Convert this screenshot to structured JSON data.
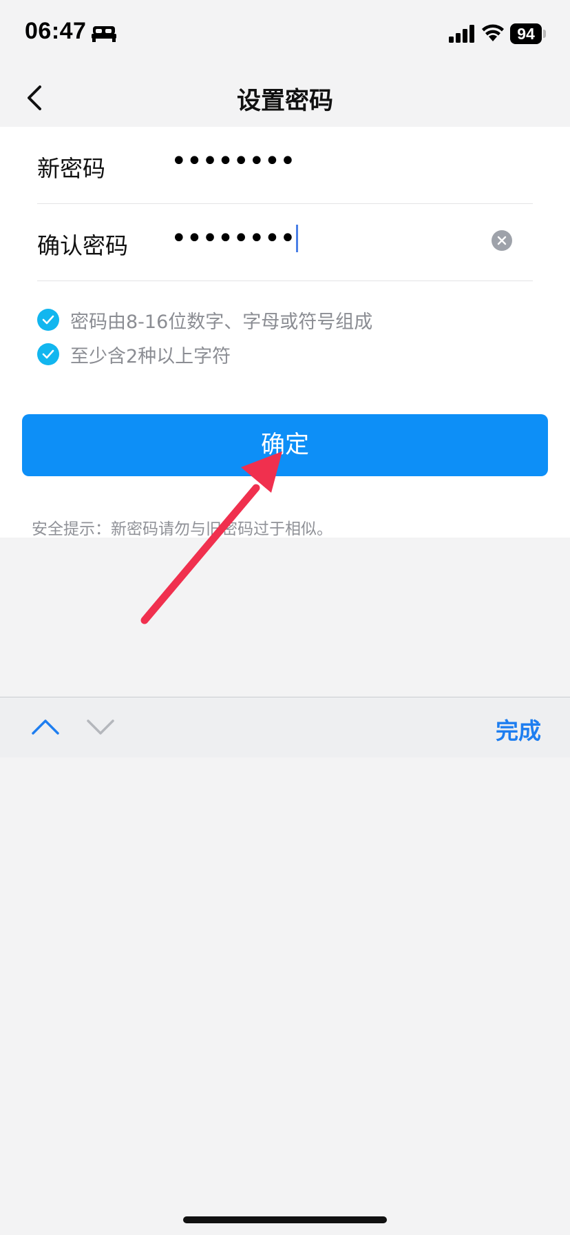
{
  "status_bar": {
    "time": "06:47",
    "focus_icon": "bed-icon",
    "battery": "94"
  },
  "nav": {
    "title": "设置密码",
    "back_icon": "chevron-left-icon"
  },
  "form": {
    "new_password": {
      "label": "新密码",
      "value": "••••••••"
    },
    "confirm_password": {
      "label": "确认密码",
      "value": "••••••••"
    }
  },
  "rules": [
    {
      "text": "密码由8-16位数字、字母或符号组成",
      "met": true
    },
    {
      "text": "至少含2种以上字符",
      "met": true
    }
  ],
  "confirm_button": {
    "label": "确定"
  },
  "security_tip": "安全提示：新密码请勿与旧密码过于相似。",
  "keyboard_toolbar": {
    "done_label": "完成"
  },
  "colors": {
    "accent": "#0d8ff7",
    "check": "#12b6ef",
    "annotation_arrow": "#f0304e",
    "done": "#1e7ef0"
  }
}
